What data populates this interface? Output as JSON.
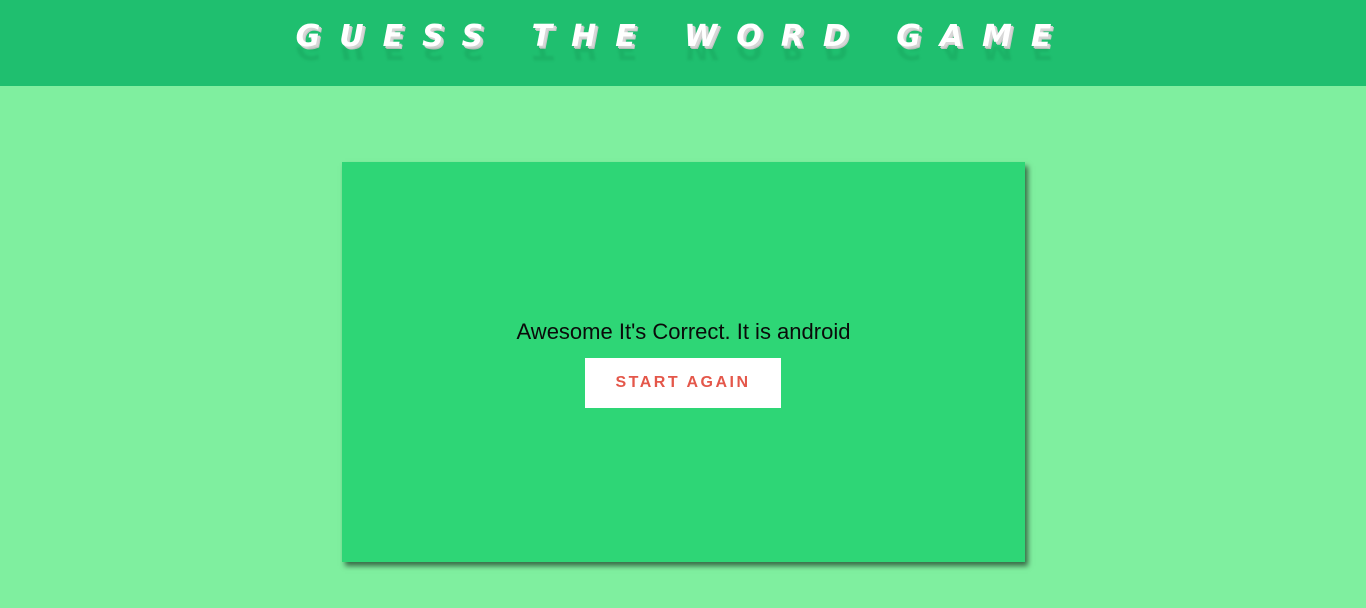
{
  "app": {
    "title": "GUESS THE WORD GAME"
  },
  "result": {
    "message": "Awesome It's Correct. It is android",
    "button_label": "START AGAIN"
  },
  "colors": {
    "page_background": "#7fef9f",
    "header_background": "#1fbf6f",
    "card_background": "#2ed676",
    "button_text": "#e4574a",
    "button_background": "#ffffff"
  }
}
